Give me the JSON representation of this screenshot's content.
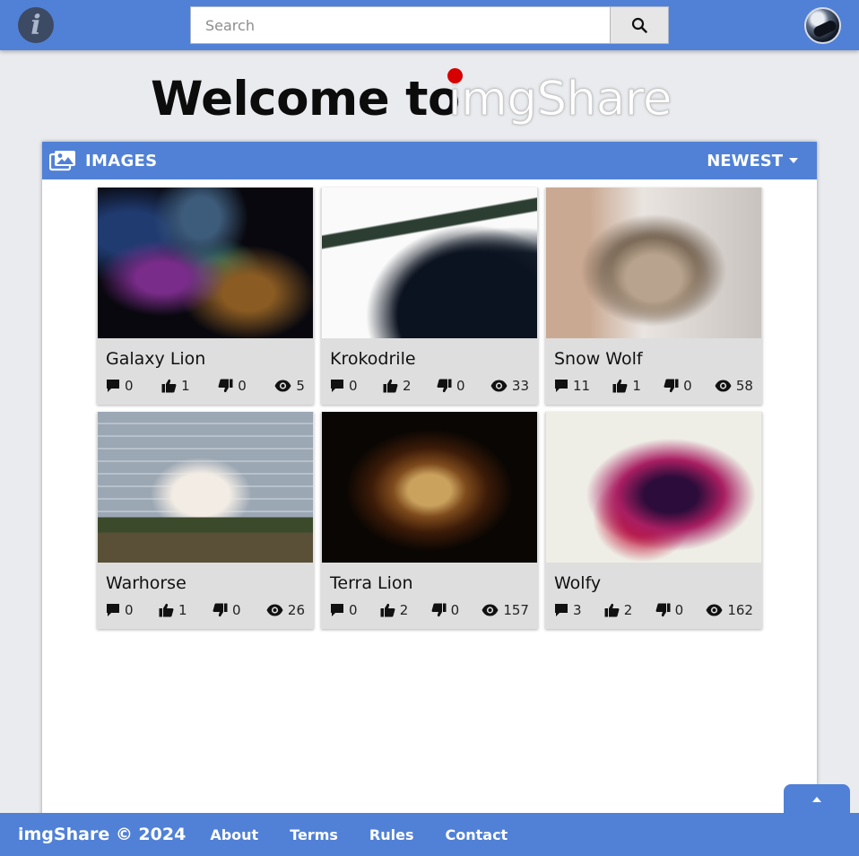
{
  "header": {
    "info_icon": "i",
    "search_placeholder": "Search",
    "search_value": ""
  },
  "hero": {
    "welcome": "Welcome to",
    "brand": "imgShare"
  },
  "panel": {
    "title": "IMAGES",
    "sort_label": "NEWEST"
  },
  "images": [
    {
      "title": "Galaxy Lion",
      "comments": "0",
      "likes": "1",
      "dislikes": "0",
      "views": "5"
    },
    {
      "title": "Krokodrile",
      "comments": "0",
      "likes": "2",
      "dislikes": "0",
      "views": "33"
    },
    {
      "title": "Snow Wolf",
      "comments": "11",
      "likes": "1",
      "dislikes": "0",
      "views": "58"
    },
    {
      "title": "Warhorse",
      "comments": "0",
      "likes": "1",
      "dislikes": "0",
      "views": "26"
    },
    {
      "title": "Terra Lion",
      "comments": "0",
      "likes": "2",
      "dislikes": "0",
      "views": "157"
    },
    {
      "title": "Wolfy",
      "comments": "3",
      "likes": "2",
      "dislikes": "0",
      "views": "162"
    }
  ],
  "footer": {
    "brand": "imgShare © 2024",
    "links": [
      "About",
      "Terms",
      "Rules",
      "Contact"
    ]
  },
  "colors": {
    "primary": "#5181d6",
    "background": "#e9ebef",
    "card": "#dedede",
    "brand_dot": "#d70000"
  }
}
